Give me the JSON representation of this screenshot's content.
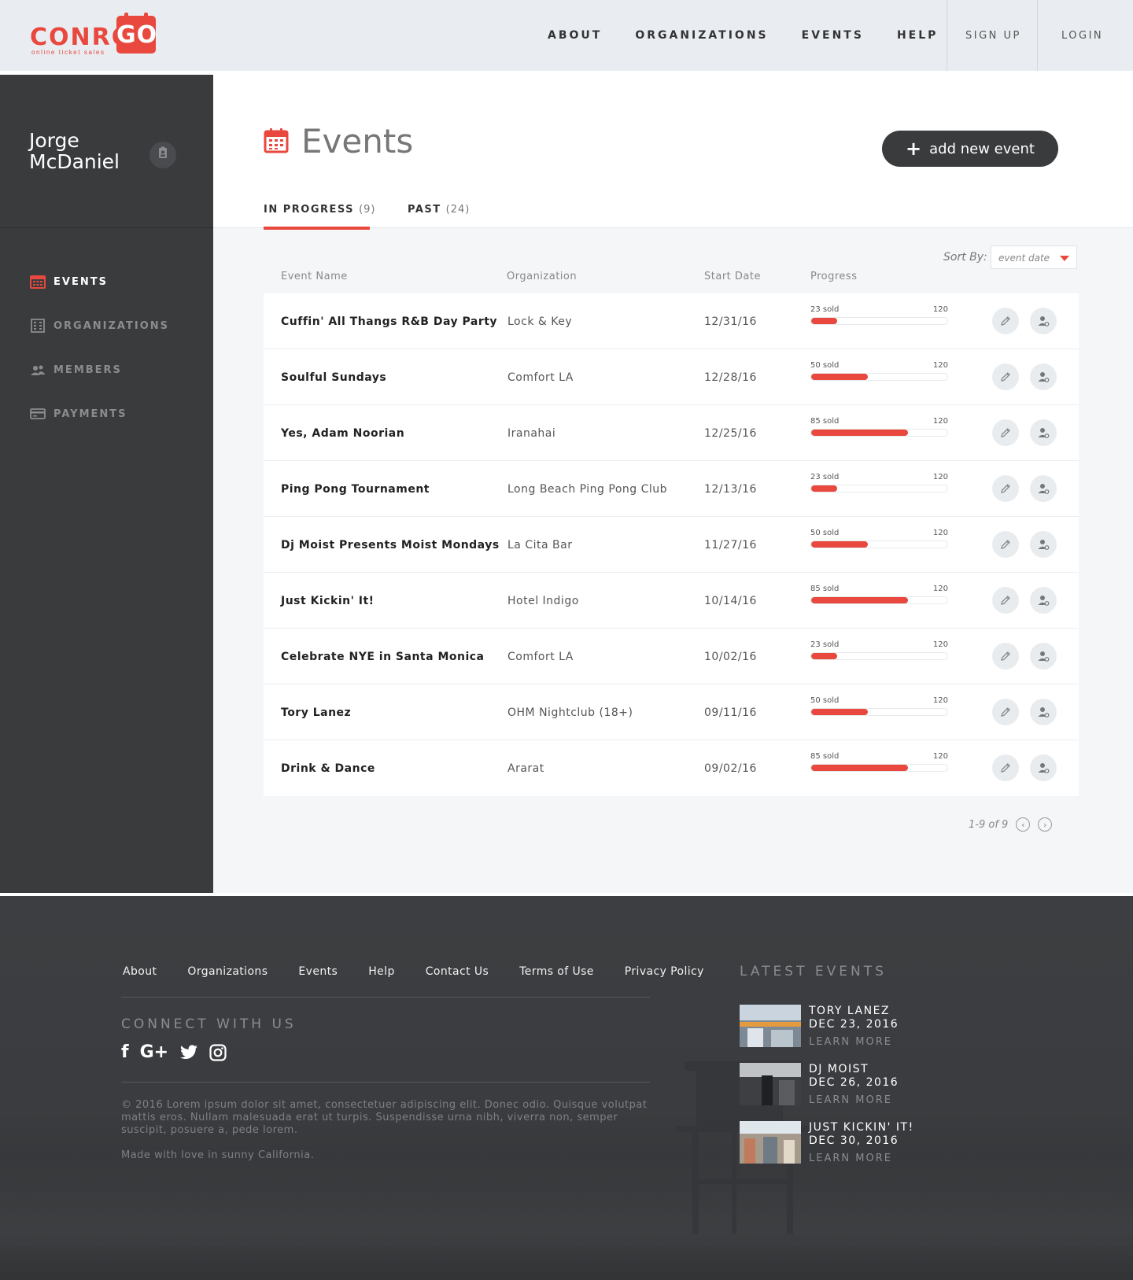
{
  "brand": {
    "name_main": "CONRO",
    "name_accent": "GO",
    "tagline": "online ticket sales"
  },
  "nav": {
    "items": [
      "ABOUT",
      "ORGANIZATIONS",
      "EVENTS",
      "HELP"
    ],
    "signup": "SIGN UP",
    "login": "LOGIN"
  },
  "user": {
    "first": "Jorge",
    "last": "McDaniel"
  },
  "sidebar": {
    "items": [
      {
        "label": "EVENTS",
        "icon": "calendar-icon",
        "active": true
      },
      {
        "label": "ORGANIZATIONS",
        "icon": "building-icon",
        "active": false
      },
      {
        "label": "MEMBERS",
        "icon": "members-icon",
        "active": false
      },
      {
        "label": "PAYMENTS",
        "icon": "credit-card-icon",
        "active": false
      }
    ]
  },
  "page": {
    "title": "Events",
    "add_button": "add new event",
    "tabs": [
      {
        "label": "IN PROGRESS",
        "count": "(9)"
      },
      {
        "label": "PAST",
        "count": "(24)"
      }
    ],
    "sort_label": "Sort By:",
    "sort_value": "event date"
  },
  "table": {
    "headers": [
      "Event Name",
      "Organization",
      "Start Date",
      "Progress"
    ],
    "rows": [
      {
        "name": "Cuffin' All Thangs R&B Day Party",
        "org": "Lock & Key",
        "date": "12/31/16",
        "sold": "23 sold",
        "sold_n": 23,
        "cap": "120"
      },
      {
        "name": "Soulful Sundays",
        "org": "Comfort LA",
        "date": "12/28/16",
        "sold": "50 sold",
        "sold_n": 50,
        "cap": "120"
      },
      {
        "name": "Yes, Adam Noorian",
        "org": "Iranahai",
        "date": "12/25/16",
        "sold": "85 sold",
        "sold_n": 85,
        "cap": "120"
      },
      {
        "name": "Ping Pong Tournament",
        "org": "Long Beach Ping Pong Club",
        "date": "12/13/16",
        "sold": "23 sold",
        "sold_n": 23,
        "cap": "120"
      },
      {
        "name": "Dj Moist Presents Moist Mondays",
        "org": "La Cita Bar",
        "date": "11/27/16",
        "sold": "50 sold",
        "sold_n": 50,
        "cap": "120"
      },
      {
        "name": "Just Kickin' It!",
        "org": "Hotel Indigo",
        "date": "10/14/16",
        "sold": "85 sold",
        "sold_n": 85,
        "cap": "120"
      },
      {
        "name": "Celebrate NYE in Santa Monica",
        "org": "Comfort LA",
        "date": "10/02/16",
        "sold": "23 sold",
        "sold_n": 23,
        "cap": "120"
      },
      {
        "name": "Tory Lanez",
        "org": "OHM Nightclub (18+)",
        "date": "09/11/16",
        "sold": "50 sold",
        "sold_n": 50,
        "cap": "120"
      },
      {
        "name": "Drink & Dance",
        "org": "Ararat",
        "date": "09/02/16",
        "sold": "85 sold",
        "sold_n": 85,
        "cap": "120"
      }
    ],
    "pager": "1-9 of 9"
  },
  "footer": {
    "links": [
      "About",
      "Organizations",
      "Events",
      "Help",
      "Contact Us",
      "Terms of Use",
      "Privacy Policy"
    ],
    "connect": "CONNECT WITH US",
    "socials": [
      "facebook-icon",
      "google-plus-icon",
      "twitter-icon",
      "instagram-icon"
    ],
    "copyright": "© 2016 Lorem ipsum dolor sit amet, consectetuer adipiscing elit. Donec odio. Quisque volutpat mattis eros. Nullam malesuada erat ut turpis. Suspendisse urna nibh, viverra non, semper suscipit, posuere a, pede lorem.",
    "made": "Made with love in sunny California.",
    "latest_title": "LATEST EVENTS",
    "latest": [
      {
        "name": "TORY LANEZ",
        "date": "DEC 23, 2016",
        "more": "LEARN MORE"
      },
      {
        "name": "DJ MOIST",
        "date": "DEC 26, 2016",
        "more": "LEARN MORE"
      },
      {
        "name": "JUST KICKIN' IT!",
        "date": "DEC 30, 2016",
        "more": "LEARN MORE"
      }
    ]
  },
  "colors": {
    "accent": "#e8483e",
    "sidebar": "#3a3b3d",
    "header": "#e9edf1"
  }
}
